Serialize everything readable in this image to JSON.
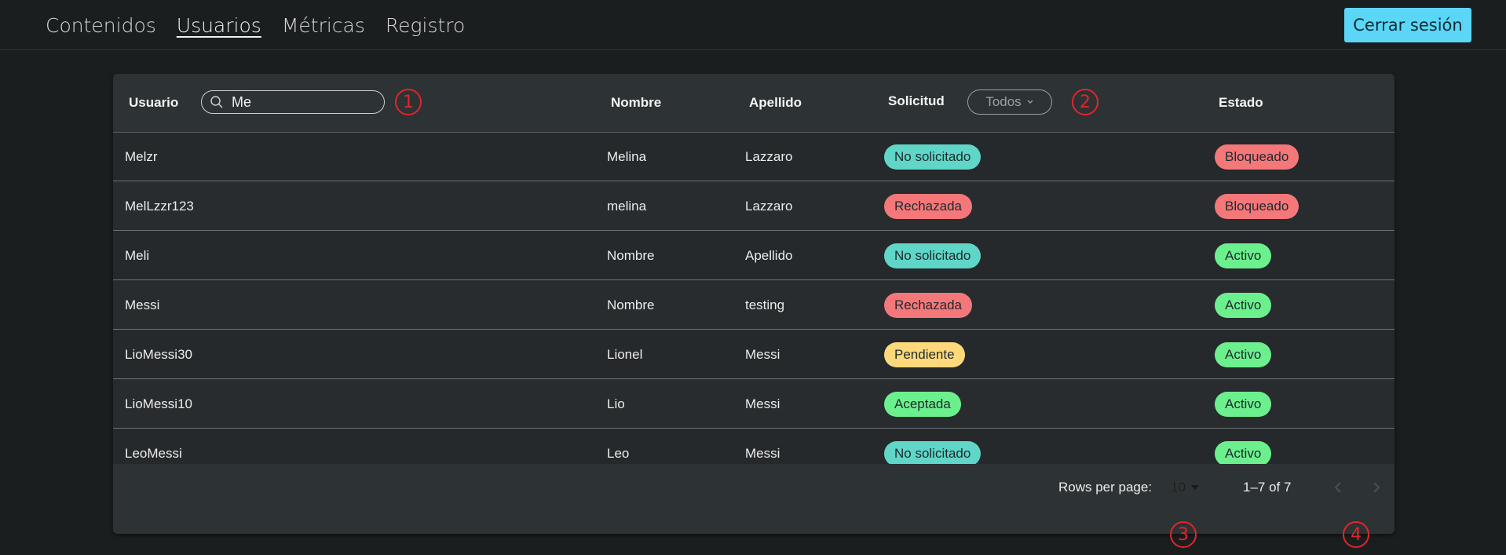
{
  "nav": {
    "items": [
      {
        "label": "Contenidos"
      },
      {
        "label": "Usuarios"
      },
      {
        "label": "Métricas"
      },
      {
        "label": "Registro"
      }
    ],
    "logout_label": "Cerrar sesión"
  },
  "table": {
    "headers": {
      "usuario": "Usuario",
      "nombre": "Nombre",
      "apellido": "Apellido",
      "solicitud": "Solicitud",
      "estado": "Estado"
    },
    "search": {
      "value": "Me",
      "icon": "search-icon"
    },
    "filter": {
      "value": "Todos",
      "icon": "chevron-down-icon"
    },
    "rows": [
      {
        "usuario": "Melzr",
        "nombre": "Melina",
        "apellido": "Lazzaro",
        "solicitud": "No solicitado",
        "estado": "Bloqueado"
      },
      {
        "usuario": "MelLzzr123",
        "nombre": "melina",
        "apellido": "Lazzaro",
        "solicitud": "Rechazada",
        "estado": "Bloqueado"
      },
      {
        "usuario": "Meli",
        "nombre": "Nombre",
        "apellido": "Apellido",
        "solicitud": "No solicitado",
        "estado": "Activo"
      },
      {
        "usuario": "Messi",
        "nombre": "Nombre",
        "apellido": "testing",
        "solicitud": "Rechazada",
        "estado": "Activo"
      },
      {
        "usuario": "LioMessi30",
        "nombre": "Lionel",
        "apellido": "Messi",
        "solicitud": "Pendiente",
        "estado": "Activo"
      },
      {
        "usuario": "LioMessi10",
        "nombre": "Lio",
        "apellido": "Messi",
        "solicitud": "Aceptada",
        "estado": "Activo"
      },
      {
        "usuario": "LeoMessi",
        "nombre": "Leo",
        "apellido": "Messi",
        "solicitud": "No solicitado",
        "estado": "Activo"
      }
    ]
  },
  "status_colors": {
    "No solicitado": "#5fd6c8",
    "Rechazada": "#f4777a",
    "Pendiente": "#fdd97b",
    "Aceptada": "#6cf08e",
    "Bloqueado": "#f4777a",
    "Activo": "#6cf08e"
  },
  "pagination": {
    "rows_per_page_label": "Rows per page:",
    "rows_per_page_value": "10",
    "range_label": "1–7 of 7"
  },
  "markers": [
    "1",
    "2",
    "3",
    "4"
  ],
  "colors": {
    "accent": "#5bd6f7",
    "marker": "#e0262b"
  }
}
